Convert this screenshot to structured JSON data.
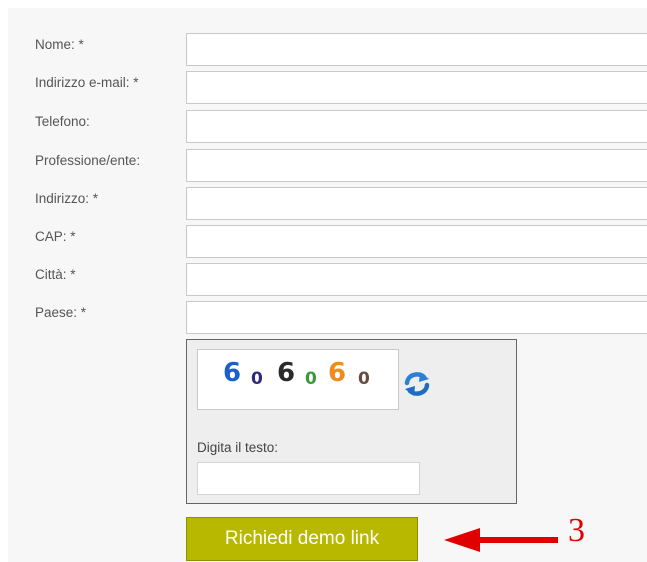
{
  "form": {
    "fields": [
      {
        "label": "Nome: *",
        "value": ""
      },
      {
        "label": "Indirizzo e-mail: *",
        "value": ""
      },
      {
        "label": "Telefono:",
        "value": ""
      },
      {
        "label": "Professione/ente:",
        "value": ""
      },
      {
        "label": "Indirizzo: *",
        "value": ""
      },
      {
        "label": "CAP: *",
        "value": ""
      },
      {
        "label": "Città: *",
        "value": ""
      },
      {
        "label": "Paese: *",
        "value": ""
      }
    ],
    "captcha": {
      "characters": [
        {
          "char": "6",
          "color": "#1a5fcc"
        },
        {
          "char": "0",
          "color": "#2b2b7a"
        },
        {
          "char": "6",
          "color": "#2b2b2b"
        },
        {
          "char": "0",
          "color": "#3a9a3a"
        },
        {
          "char": "6",
          "color": "#f08c1e"
        },
        {
          "char": "0",
          "color": "#6a4a3a"
        }
      ],
      "refresh_icon": "refresh-icon",
      "input_label": "Digita il testo:",
      "input_value": ""
    },
    "submit_label": "Richiedi demo link"
  },
  "annotation": {
    "number": "3",
    "color": "#e00000"
  },
  "colors": {
    "button_bg": "#b8b800",
    "panel_bg": "#f7f7f7"
  }
}
